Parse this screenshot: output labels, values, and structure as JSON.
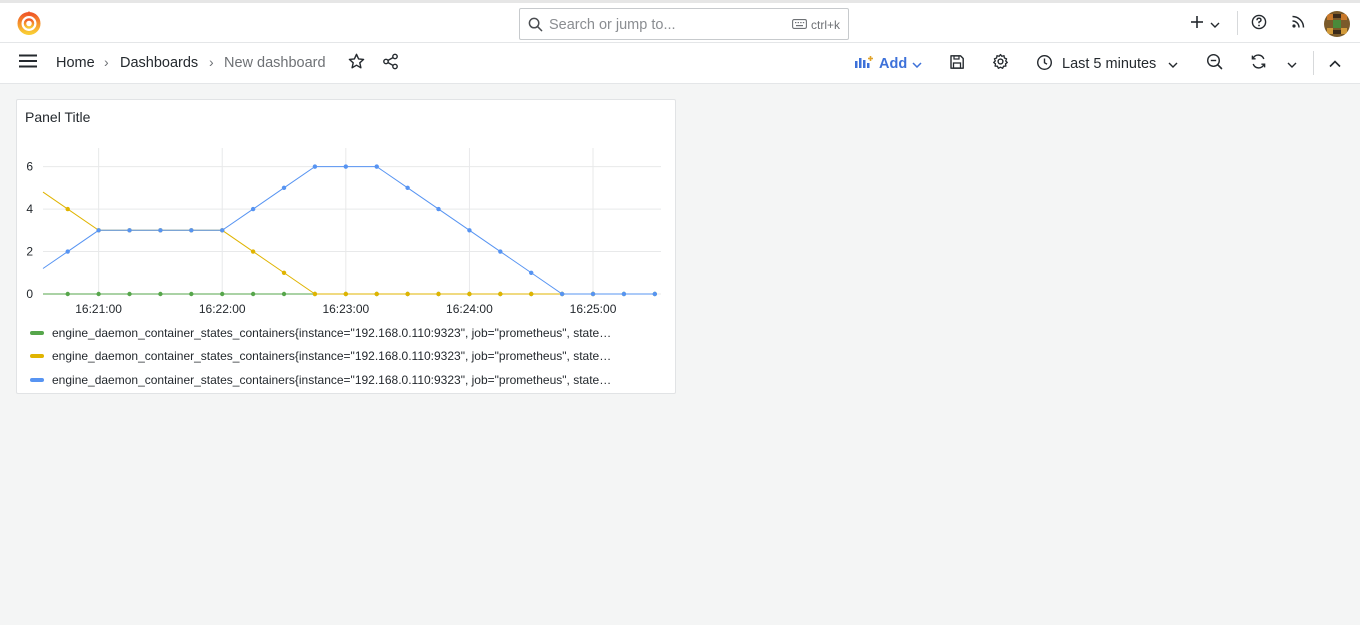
{
  "app": {
    "search_placeholder": "Search or jump to...",
    "search_shortcut": "ctrl+k"
  },
  "breadcrumb": {
    "home": "Home",
    "dashboards": "Dashboards",
    "current": "New dashboard"
  },
  "toolbar": {
    "add_label": "Add",
    "time_range_label": "Last 5 minutes"
  },
  "icons": {
    "logo": "grafana-logo-icon",
    "search": "search-icon",
    "keyboard": "keyboard-icon",
    "new": "plus-icon",
    "help": "help-circle-icon",
    "news": "rss-icon",
    "menu": "hamburger-menu-icon",
    "star": "star-icon",
    "share": "share-icon",
    "add_panel": "add-panel-icon",
    "save": "save-icon",
    "settings": "gear-icon",
    "clock": "clock-icon",
    "zoom_out": "zoom-out-icon",
    "refresh": "refresh-icon",
    "collapse": "chevron-up-icon"
  },
  "colors": {
    "accent": "#3d71d9",
    "series_green": "#56a64b",
    "series_yellow": "#e0b400",
    "series_blue": "#5794f2"
  },
  "panel": {
    "title": "Panel Title"
  },
  "chart_data": {
    "type": "line",
    "title": "Panel Title",
    "xlabel": "",
    "ylabel": "",
    "ylim": [
      0,
      6.5
    ],
    "yticks": [
      0,
      2,
      4,
      6
    ],
    "x_tick_labels": [
      "16:21:00",
      "16:22:00",
      "16:23:00",
      "16:24:00",
      "16:25:00"
    ],
    "x": [
      "16:20:33",
      "16:20:45",
      "16:21:00",
      "16:21:15",
      "16:21:30",
      "16:21:45",
      "16:22:00",
      "16:22:15",
      "16:22:30",
      "16:22:45",
      "16:23:00",
      "16:23:15",
      "16:23:30",
      "16:23:45",
      "16:24:00",
      "16:24:15",
      "16:24:30",
      "16:24:45",
      "16:25:00",
      "16:25:15",
      "16:25:30"
    ],
    "grid": true,
    "legend_position": "bottom",
    "series": [
      {
        "name": "engine_daemon_container_states_containers{instance=\"192.168.0.110:9323\", job=\"prometheus\", state…",
        "color": "#56a64b",
        "values": [
          0,
          0,
          0,
          0,
          0,
          0,
          0,
          0,
          0,
          0,
          0,
          0,
          0,
          0,
          0,
          0,
          0,
          0,
          0,
          0,
          0
        ]
      },
      {
        "name": "engine_daemon_container_states_containers{instance=\"192.168.0.110:9323\", job=\"prometheus\", state…",
        "color": "#e0b400",
        "values": [
          4.8,
          4,
          3,
          3,
          3,
          3,
          3,
          2,
          1,
          0,
          0,
          0,
          0,
          0,
          0,
          0,
          0,
          0,
          0,
          null,
          null
        ]
      },
      {
        "name": "engine_daemon_container_states_containers{instance=\"192.168.0.110:9323\", job=\"prometheus\", state…",
        "color": "#5794f2",
        "values": [
          1.2,
          2,
          3,
          3,
          3,
          3,
          3,
          4,
          5,
          6,
          6,
          6,
          5,
          4,
          3,
          2,
          1,
          0,
          0,
          0,
          0
        ]
      }
    ]
  }
}
